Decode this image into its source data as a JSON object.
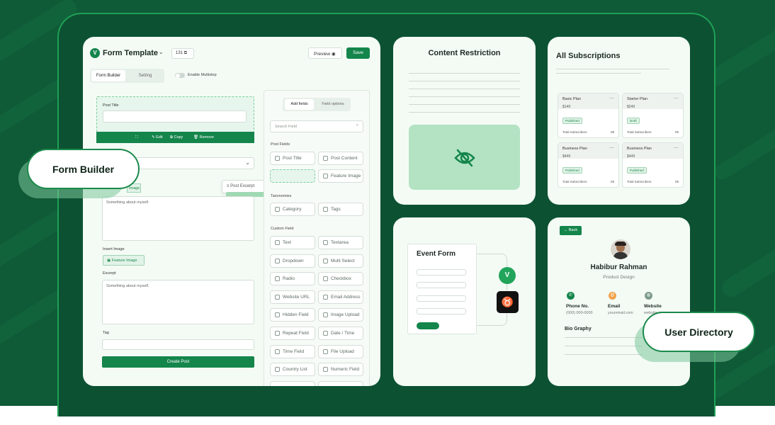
{
  "colors": {
    "brand": "#14854b",
    "bg": "#0f5a37",
    "card": "#f4fbf5"
  },
  "form_builder": {
    "title": "Form Template",
    "count": "131",
    "preview": "Preview",
    "save": "Save",
    "tabs": [
      "Form Builder",
      "Setting"
    ],
    "multistep": "Enable Multistep",
    "post_title_label": "Post Title",
    "toolbar": {
      "edit": "Edit",
      "copy": "Copy",
      "remove": "Remove"
    },
    "feature_image_small": "Image",
    "drag_chip": "Post Excerpt",
    "about_placeholder": "Something about myself.",
    "insert_image_label": "Insert Image",
    "feature_image_btn": "Feature Image",
    "excerpt_label": "Excerpt",
    "excerpt_placeholder": "Something about myself.",
    "tag_label": "Tag",
    "create_post": "Create Post"
  },
  "fields_panel": {
    "tabs": [
      "Add fields",
      "Field options"
    ],
    "search_placeholder": "Search Field",
    "sections": {
      "post": "Post Fields",
      "tax": "Taxonomies",
      "custom": "Custom Field"
    },
    "post_fields": [
      "Post Title",
      "Post Content",
      "",
      "Feature Image"
    ],
    "taxonomies": [
      "Category",
      "Tags"
    ],
    "custom_fields": [
      "Text",
      "Textarea",
      "Dropdown",
      "Multi Select",
      "Radio",
      "Checkbox",
      "Website URL",
      "Email Address",
      "Hidden Field",
      "Image Upload",
      "Repeat Field",
      "Date / Time",
      "Time Field",
      "File Upload",
      "Country List",
      "Numeric Field"
    ]
  },
  "pills": {
    "form_builder": "Form Builder",
    "user_directory": "User Directory"
  },
  "content_restriction": {
    "title": "Content Restriction"
  },
  "subscriptions": {
    "title": "All Subscriptions",
    "plans": [
      {
        "name": "Basic Plan",
        "price": "$149",
        "badge": "Published",
        "label": "Total Subscribers",
        "count": "08"
      },
      {
        "name": "Starter Plan",
        "price": "$249",
        "badge": "Draft",
        "label": "Total Subscribers",
        "count": "09"
      },
      {
        "name": "Business Plan",
        "price": "$449",
        "badge": "Published",
        "label": "Total Subscribers",
        "count": "09"
      },
      {
        "name": "Business Plan",
        "price": "$449",
        "badge": "Published",
        "label": "Total Subscribers",
        "count": "09"
      }
    ]
  },
  "event_form": {
    "title": "Event Form"
  },
  "user_directory": {
    "back": "Back",
    "name": "Habibur Rahman",
    "role": "Product Design",
    "contacts": [
      {
        "label": "Phone No.",
        "value": "(000) 000-0000"
      },
      {
        "label": "Email",
        "value": "youremail.com"
      },
      {
        "label": "Website",
        "value": "website.com"
      }
    ],
    "bio": "Bio Graphy"
  }
}
